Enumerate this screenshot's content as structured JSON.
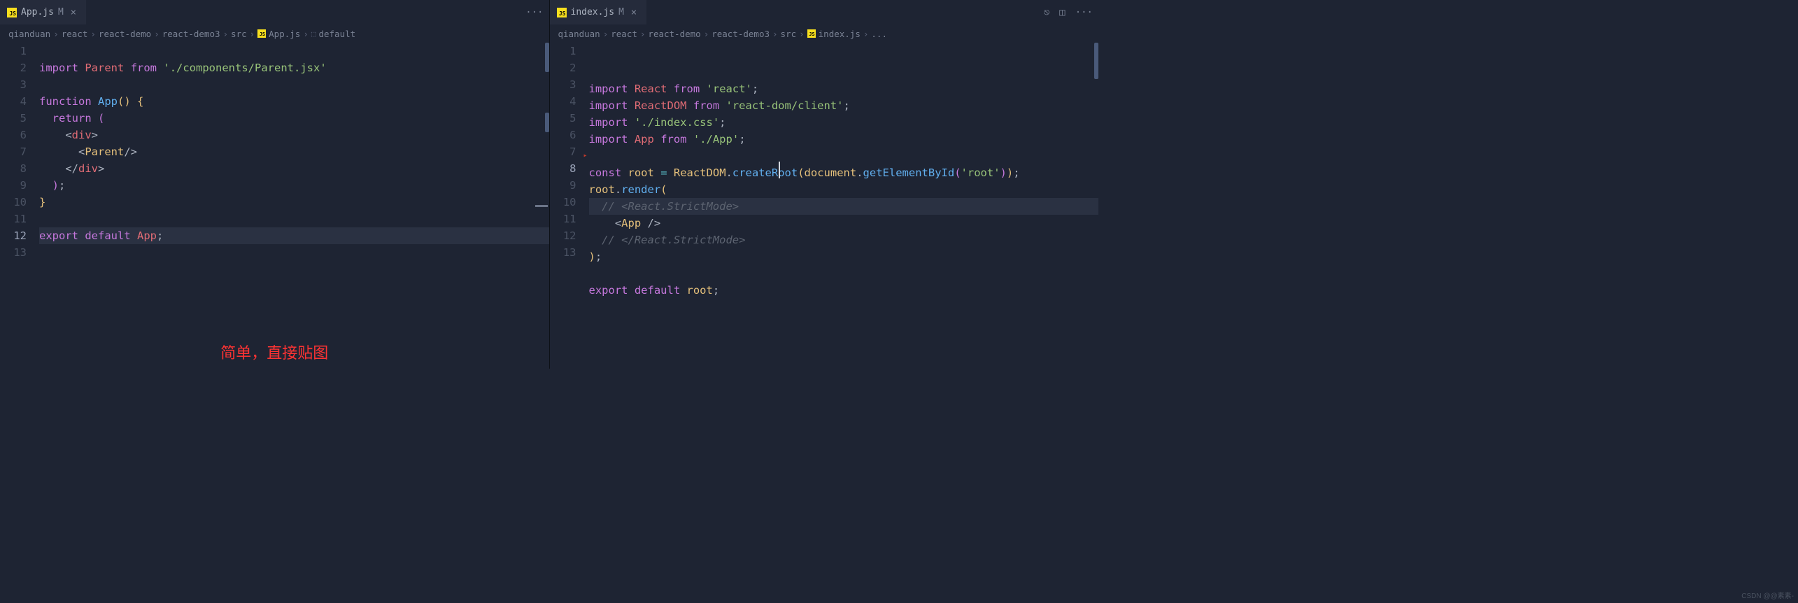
{
  "left": {
    "tab": {
      "icon": "JS",
      "name": "App.js",
      "modified": "M"
    },
    "ellipsis": "···",
    "breadcrumbs": [
      "qianduan",
      "react",
      "react-demo",
      "react-demo3",
      "src",
      {
        "icon": "JS",
        "name": "App.js"
      },
      {
        "sym": "⬚",
        "name": "default"
      }
    ],
    "lines": [
      {
        "n": 1,
        "seg": []
      },
      {
        "n": 2,
        "seg": [
          {
            "c": "kw",
            "t": "import"
          },
          {
            "c": "pn",
            "t": " "
          },
          {
            "c": "idv",
            "t": "Parent"
          },
          {
            "c": "pn",
            "t": " "
          },
          {
            "c": "kw",
            "t": "from"
          },
          {
            "c": "pn",
            "t": " "
          },
          {
            "c": "str",
            "t": "'./components/Parent.jsx'"
          }
        ]
      },
      {
        "n": 3,
        "seg": []
      },
      {
        "n": 4,
        "seg": [
          {
            "c": "kw",
            "t": "function"
          },
          {
            "c": "pn",
            "t": " "
          },
          {
            "c": "fn",
            "t": "App"
          },
          {
            "c": "br-y",
            "t": "()"
          },
          {
            "c": "pn",
            "t": " "
          },
          {
            "c": "br-y",
            "t": "{"
          }
        ]
      },
      {
        "n": 5,
        "seg": [
          {
            "c": "pn",
            "t": "  "
          },
          {
            "c": "kw",
            "t": "return"
          },
          {
            "c": "pn",
            "t": " "
          },
          {
            "c": "br-p",
            "t": "("
          }
        ]
      },
      {
        "n": 6,
        "seg": [
          {
            "c": "pn",
            "t": "    "
          },
          {
            "c": "pn",
            "t": "<"
          },
          {
            "c": "tag",
            "t": "div"
          },
          {
            "c": "pn",
            "t": ">"
          }
        ]
      },
      {
        "n": 7,
        "seg": [
          {
            "c": "pn",
            "t": "      "
          },
          {
            "c": "pn",
            "t": "<"
          },
          {
            "c": "id",
            "t": "Parent"
          },
          {
            "c": "pn",
            "t": "/>"
          }
        ]
      },
      {
        "n": 8,
        "seg": [
          {
            "c": "pn",
            "t": "    "
          },
          {
            "c": "pn",
            "t": "</"
          },
          {
            "c": "tag",
            "t": "div"
          },
          {
            "c": "pn",
            "t": ">"
          }
        ]
      },
      {
        "n": 9,
        "seg": [
          {
            "c": "pn",
            "t": "  "
          },
          {
            "c": "br-p",
            "t": ")"
          },
          {
            "c": "pn",
            "t": ";"
          }
        ]
      },
      {
        "n": 10,
        "seg": [
          {
            "c": "br-y",
            "t": "}"
          }
        ]
      },
      {
        "n": 11,
        "seg": []
      },
      {
        "n": 12,
        "hl": true,
        "seg": [
          {
            "c": "kw",
            "t": "export"
          },
          {
            "c": "pn",
            "t": " "
          },
          {
            "c": "kw",
            "t": "default"
          },
          {
            "c": "pn",
            "t": " "
          },
          {
            "c": "idv",
            "t": "App"
          },
          {
            "c": "pn",
            "t": ";"
          }
        ]
      },
      {
        "n": 13,
        "seg": []
      }
    ],
    "overlay": "简单，直接贴图"
  },
  "right": {
    "tab": {
      "icon": "JS",
      "name": "index.js",
      "modified": "M"
    },
    "actions": [
      "git-compare-icon",
      "split-icon",
      "more-icon"
    ],
    "breadcrumbs": [
      "qianduan",
      "react",
      "react-demo",
      "react-demo3",
      "src",
      {
        "icon": "JS",
        "name": "index.js"
      },
      {
        "name": "..."
      }
    ],
    "lines": [
      {
        "n": 1,
        "seg": [
          {
            "c": "kw",
            "t": "import"
          },
          {
            "c": "pn",
            "t": " "
          },
          {
            "c": "idv",
            "t": "React"
          },
          {
            "c": "pn",
            "t": " "
          },
          {
            "c": "kw",
            "t": "from"
          },
          {
            "c": "pn",
            "t": " "
          },
          {
            "c": "str",
            "t": "'react'"
          },
          {
            "c": "pn",
            "t": ";"
          }
        ]
      },
      {
        "n": 2,
        "seg": [
          {
            "c": "kw",
            "t": "import"
          },
          {
            "c": "pn",
            "t": " "
          },
          {
            "c": "idv",
            "t": "ReactDOM"
          },
          {
            "c": "pn",
            "t": " "
          },
          {
            "c": "kw",
            "t": "from"
          },
          {
            "c": "pn",
            "t": " "
          },
          {
            "c": "str",
            "t": "'react-dom/client'"
          },
          {
            "c": "pn",
            "t": ";"
          }
        ]
      },
      {
        "n": 3,
        "seg": [
          {
            "c": "kw",
            "t": "import"
          },
          {
            "c": "pn",
            "t": " "
          },
          {
            "c": "str",
            "t": "'./index.css'"
          },
          {
            "c": "pn",
            "t": ";"
          }
        ]
      },
      {
        "n": 4,
        "seg": [
          {
            "c": "kw",
            "t": "import"
          },
          {
            "c": "pn",
            "t": " "
          },
          {
            "c": "idv",
            "t": "App"
          },
          {
            "c": "pn",
            "t": " "
          },
          {
            "c": "kw",
            "t": "from"
          },
          {
            "c": "pn",
            "t": " "
          },
          {
            "c": "str",
            "t": "'./App'"
          },
          {
            "c": "pn",
            "t": ";"
          }
        ]
      },
      {
        "n": 5,
        "ind": true,
        "seg": []
      },
      {
        "n": 6,
        "seg": [
          {
            "c": "kw",
            "t": "const"
          },
          {
            "c": "pn",
            "t": " "
          },
          {
            "c": "id",
            "t": "root"
          },
          {
            "c": "pn",
            "t": " "
          },
          {
            "c": "op",
            "t": "="
          },
          {
            "c": "pn",
            "t": " "
          },
          {
            "c": "id",
            "t": "ReactDOM"
          },
          {
            "c": "pn",
            "t": "."
          },
          {
            "c": "fn",
            "t": "createRoot"
          },
          {
            "c": "br-y",
            "t": "("
          },
          {
            "c": "id",
            "t": "document"
          },
          {
            "c": "pn",
            "t": "."
          },
          {
            "c": "fn",
            "t": "getElementById"
          },
          {
            "c": "br-p",
            "t": "("
          },
          {
            "c": "str",
            "t": "'root'"
          },
          {
            "c": "br-p",
            "t": ")"
          },
          {
            "c": "br-y",
            "t": ")"
          },
          {
            "c": "pn",
            "t": ";"
          }
        ]
      },
      {
        "n": 7,
        "seg": [
          {
            "c": "id",
            "t": "root"
          },
          {
            "c": "pn",
            "t": "."
          },
          {
            "c": "fn",
            "t": "render"
          },
          {
            "c": "br-y",
            "t": "("
          }
        ]
      },
      {
        "n": 8,
        "hl": true,
        "seg": [
          {
            "c": "pn",
            "t": "  "
          },
          {
            "c": "cm",
            "t": "// <React.StrictMode>"
          }
        ]
      },
      {
        "n": 9,
        "seg": [
          {
            "c": "pn",
            "t": "    "
          },
          {
            "c": "pn",
            "t": "<"
          },
          {
            "c": "id",
            "t": "App"
          },
          {
            "c": "pn",
            "t": " />"
          }
        ]
      },
      {
        "n": 10,
        "seg": [
          {
            "c": "pn",
            "t": "  "
          },
          {
            "c": "cm",
            "t": "// </React.StrictMode>"
          }
        ]
      },
      {
        "n": 11,
        "seg": [
          {
            "c": "br-y",
            "t": ")"
          },
          {
            "c": "pn",
            "t": ";"
          }
        ]
      },
      {
        "n": 12,
        "seg": []
      },
      {
        "n": 13,
        "seg": [
          {
            "c": "kw",
            "t": "export"
          },
          {
            "c": "pn",
            "t": " "
          },
          {
            "c": "kw",
            "t": "default"
          },
          {
            "c": "pn",
            "t": " "
          },
          {
            "c": "id",
            "t": "root"
          },
          {
            "c": "pn",
            "t": ";"
          }
        ]
      }
    ]
  },
  "watermark": "CSDN @@素素-"
}
